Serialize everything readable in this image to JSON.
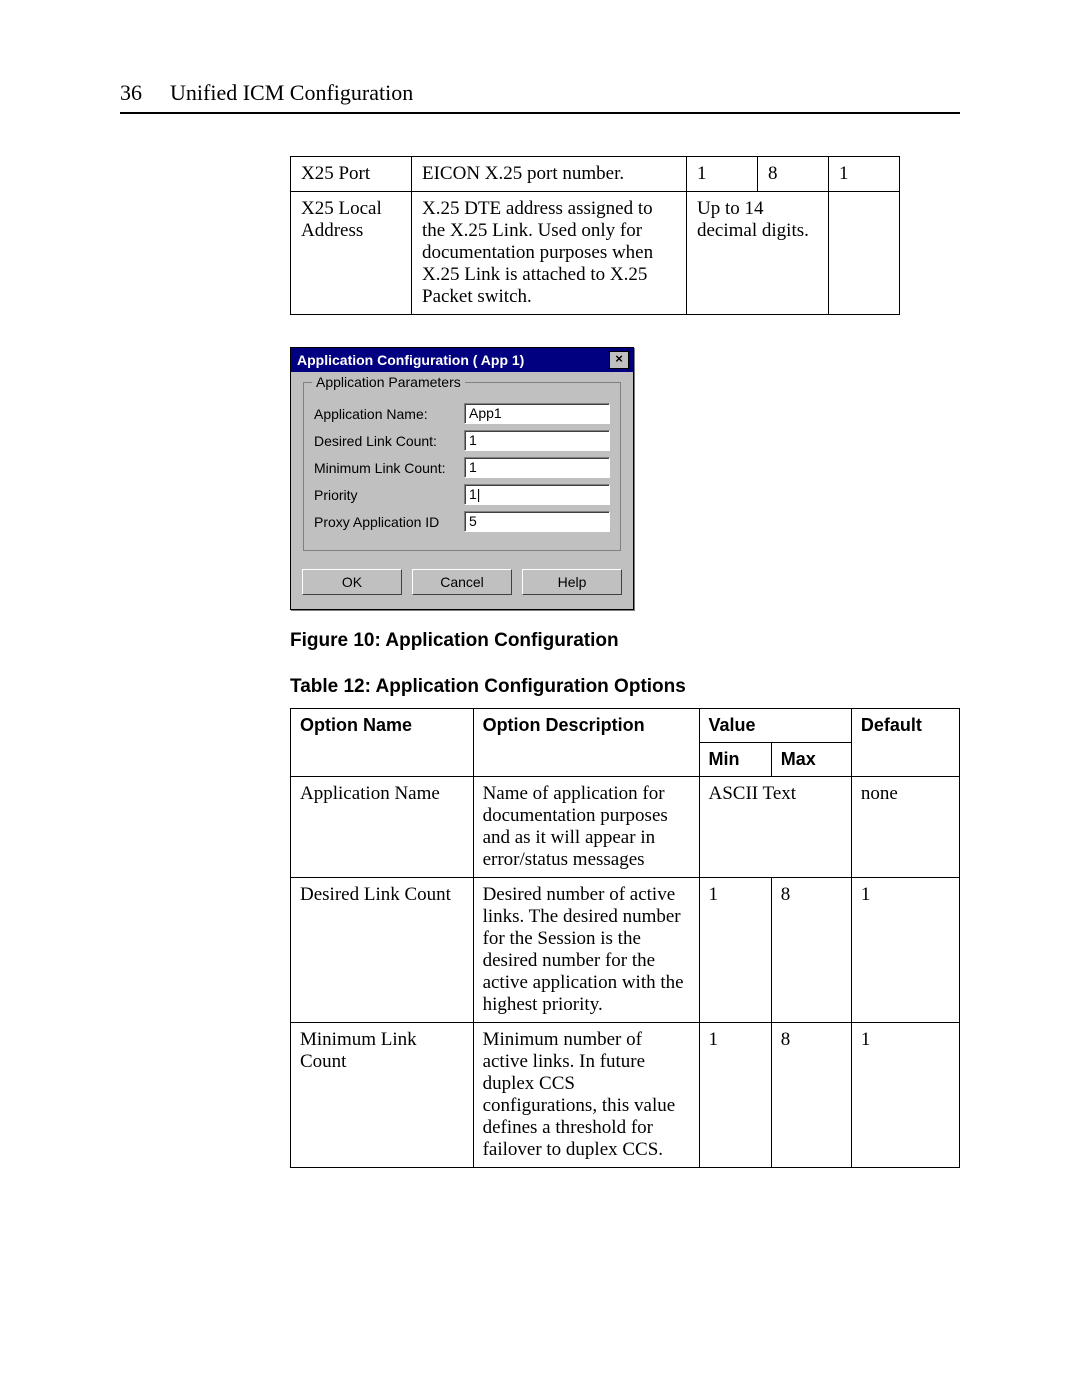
{
  "header": {
    "page_number": "36",
    "title": "Unified ICM Configuration"
  },
  "table1": {
    "rows": [
      {
        "name": "X25 Port",
        "desc": "EICON X.25 port number.",
        "c": "1",
        "d": "8",
        "e": "1"
      },
      {
        "name": "X25 Local Address",
        "desc": "X.25 DTE address assigned to the X.25 Link. Used only for documentation purposes when X.25 Link is attached to X.25 Packet switch.",
        "cd": "Up to 14 decimal digits.",
        "e": ""
      }
    ]
  },
  "dialog": {
    "title": "Application Configuration ( App 1)",
    "groupbox": "Application Parameters",
    "fields": {
      "app_name_label": "Application Name:",
      "app_name_value": "App1",
      "desired_label": "Desired Link Count:",
      "desired_value": "1",
      "minimum_label": "Minimum Link Count:",
      "minimum_value": "1",
      "priority_label": "Priority",
      "priority_value": "1|",
      "proxy_label": "Proxy Application ID",
      "proxy_value": "5"
    },
    "buttons": {
      "ok": "OK",
      "cancel": "Cancel",
      "help": "Help"
    }
  },
  "figure_caption": "Figure 10: Application Configuration",
  "table_caption": "Table 12: Application Configuration Options",
  "table2": {
    "head": {
      "option_name": "Option Name",
      "option_desc": "Option Description",
      "value": "Value",
      "default": "Default",
      "min": "Min",
      "max": "Max"
    },
    "rows": [
      {
        "name": "Application Name",
        "desc": "Name of application for documentation purposes and as it will appear in error/status messages",
        "minmax": "ASCII Text",
        "default": "none"
      },
      {
        "name": "Desired Link Count",
        "desc": "Desired number of active links. The desired number for the Session is the desired number for the active application with the highest priority.",
        "min": "1",
        "max": "8",
        "default": "1"
      },
      {
        "name": "Minimum Link Count",
        "desc": "Minimum number of active links. In future duplex CCS configurations, this value defines a threshold for failover to duplex CCS.",
        "min": "1",
        "max": "8",
        "default": "1"
      }
    ]
  }
}
